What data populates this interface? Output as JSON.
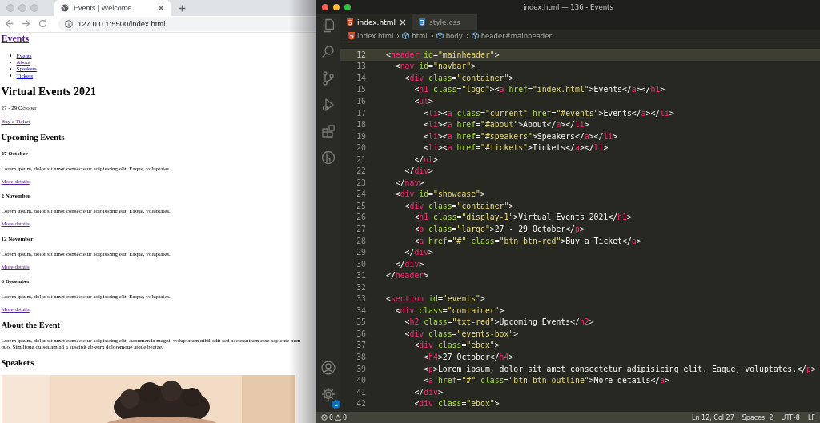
{
  "browser": {
    "tab_title": "Events | Welcome",
    "url": "127.0.0.1:5500/index.html",
    "page": {
      "logo": {
        "text": "Events",
        "visited": true
      },
      "nav": [
        {
          "text": "Events",
          "visited": false
        },
        {
          "text": "About",
          "visited": true
        },
        {
          "text": "Speakers",
          "visited": false
        },
        {
          "text": "Tickets",
          "visited": false
        }
      ],
      "title": "Virtual Events 2021",
      "dates": "27 - 29 October",
      "ticket_link": {
        "text": "Buy a Ticket",
        "visited": true
      },
      "events_heading": "Upcoming Events",
      "events": [
        {
          "date": "27 October",
          "text": "Lorem ipsum, dolor sit amet consectetur adipisicing elit. Eaque, voluptates.",
          "link": "More details"
        },
        {
          "date": "2 November",
          "text": "Lorem ipsum, dolor sit amet consectetur adipisicing elit. Eaque, voluptates.",
          "link": "More details"
        },
        {
          "date": "12 November",
          "text": "Lorem ipsum, dolor sit amet consectetur adipisicing elit. Eaque, voluptates.",
          "link": "More details"
        },
        {
          "date": "6 December",
          "text": "Lorem ipsum, dolor sit amet consectetur adipisicing elit. Eaque, voluptates.",
          "link": "More details"
        }
      ],
      "about_heading": "About the Event",
      "about_text": "Lorem ipsum, dolor sit amet consectetur adipisicing elit. Assumenda magni, voluptatum nihil odit sed accusantium esse sapiente num\nquo. Similique quisquam ad a suscipit ab eum doloremque atque beatae.",
      "speakers_heading": "Speakers"
    }
  },
  "editor": {
    "window_title": "index.html — 136 - Events",
    "tabs": [
      {
        "label": "index.html",
        "kind": "html",
        "selected": true
      },
      {
        "label": "style.css",
        "kind": "css",
        "selected": false
      }
    ],
    "breadcrumb": [
      {
        "label": "index.html",
        "kind": "file"
      },
      {
        "label": "html",
        "kind": "symbol"
      },
      {
        "label": "body",
        "kind": "symbol"
      },
      {
        "label": "header#mainheader",
        "kind": "symbol"
      }
    ],
    "lines": [
      {
        "n": "12",
        "code": "<header id=\"mainheader\">",
        "selected": true
      },
      {
        "n": "13",
        "code": "  <nav id=\"navbar\">",
        "selected": false
      },
      {
        "n": "14",
        "code": "    <div class=\"container\">",
        "selected": false
      },
      {
        "n": "15",
        "code": "      <h1 class=\"logo\"><a href=\"index.html\">Events</a></h1>",
        "selected": false
      },
      {
        "n": "16",
        "code": "      <ul>",
        "selected": false
      },
      {
        "n": "17",
        "code": "        <li><a class=\"current\" href=\"#events\">Events</a></li>",
        "selected": false
      },
      {
        "n": "18",
        "code": "        <li><a href=\"#about\">About</a></li>",
        "selected": false
      },
      {
        "n": "19",
        "code": "        <li><a href=\"#speakers\">Speakers</a></li>",
        "selected": false
      },
      {
        "n": "20",
        "code": "        <li><a href=\"#tickets\">Tickets</a></li>",
        "selected": false
      },
      {
        "n": "21",
        "code": "      </ul>",
        "selected": false
      },
      {
        "n": "22",
        "code": "    </div>",
        "selected": false
      },
      {
        "n": "23",
        "code": "  </nav>",
        "selected": false
      },
      {
        "n": "24",
        "code": "  <div id=\"showcase\">",
        "selected": false
      },
      {
        "n": "25",
        "code": "    <div class=\"container\">",
        "selected": false
      },
      {
        "n": "26",
        "code": "      <h1 class=\"display-1\">Virtual Events 2021</h1>",
        "selected": false
      },
      {
        "n": "27",
        "code": "      <p class=\"large\">27 - 29 October</p>",
        "selected": false
      },
      {
        "n": "28",
        "code": "      <a href=\"#\" class=\"btn btn-red\">Buy a Ticket</a>",
        "selected": false
      },
      {
        "n": "29",
        "code": "    </div>",
        "selected": false
      },
      {
        "n": "30",
        "code": "  </div>",
        "selected": false
      },
      {
        "n": "31",
        "code": "</header>",
        "selected": false
      },
      {
        "n": "32",
        "selected": false
      },
      {
        "n": "33",
        "code": "<section id=\"events\">",
        "selected": false
      },
      {
        "n": "34",
        "code": "  <div class=\"container\">",
        "selected": false
      },
      {
        "n": "35",
        "code": "    <h2 class=\"txt-red\">Upcoming Events</h2>",
        "selected": false
      },
      {
        "n": "36",
        "code": "    <div class=\"events-box\">",
        "selected": false
      },
      {
        "n": "37",
        "code": "      <div class=\"ebox\">",
        "selected": false
      },
      {
        "n": "38",
        "code": "        <h4>27 October</h4>",
        "selected": false
      },
      {
        "n": "39",
        "code": "        <p>Lorem ipsum, dolor sit amet consectetur adipisicing elit. Eaque, voluptates.</p>",
        "selected": false
      },
      {
        "n": "40",
        "code": "        <a href=\"#\" class=\"btn btn-outline\">More details</a>",
        "selected": false
      },
      {
        "n": "41",
        "code": "      </div>",
        "selected": false
      },
      {
        "n": "42",
        "code": "      <div class=\"ebox\">",
        "selected": false
      }
    ],
    "settings_badge": "1",
    "status_bar": {
      "errors": "0",
      "warnings": "0",
      "position": "Ln 12, Col 27",
      "spaces": "Spaces: 2",
      "encoding": "UTF-8",
      "eol": "LF"
    }
  }
}
